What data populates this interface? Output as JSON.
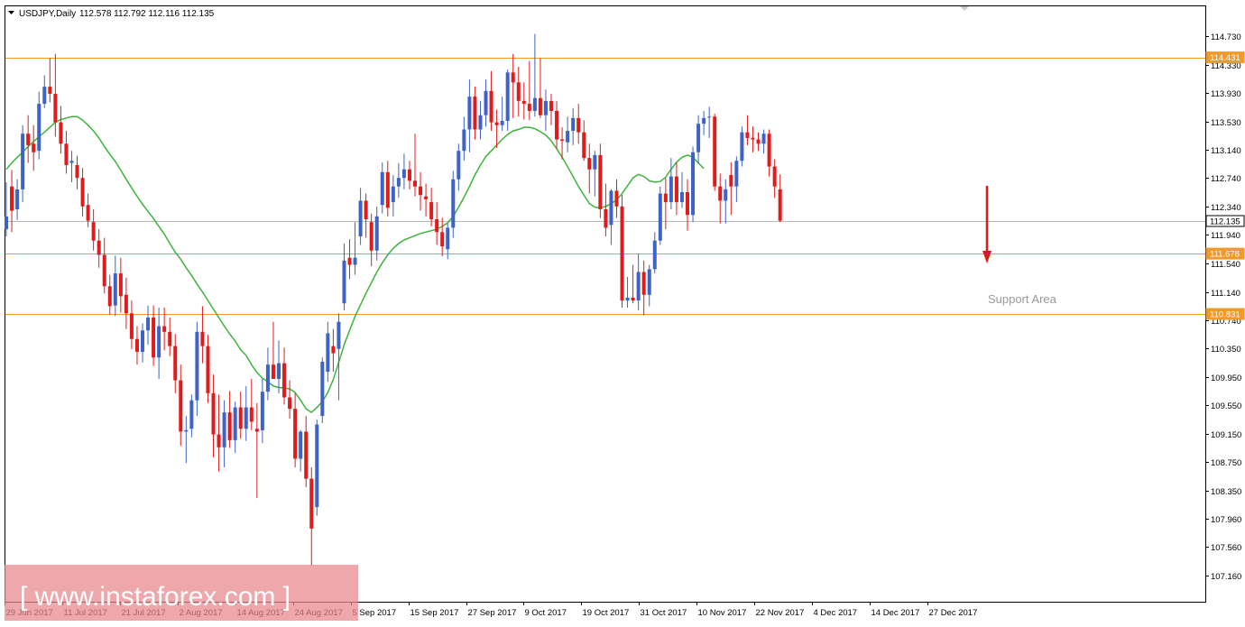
{
  "header": {
    "symbol_label": "USDJPY,Daily",
    "ohlc_label": "112.578 112.792 112.116 112.135"
  },
  "watermark": {
    "text": "[ www.instaforex.com ]"
  },
  "annotation": {
    "text": "Support Area"
  },
  "colors": {
    "bull": "#3f62c7",
    "bear": "#e01b1b",
    "ma": "#3cb43c",
    "level": "#f09a2a",
    "current": "#b8b8b8",
    "arrow": "#d81a1a",
    "watermark_bg": "#e8868c"
  },
  "chart_data": {
    "type": "candlestick",
    "title": "USDJPY,Daily",
    "y_ticks": [
      "114.730",
      "114.330",
      "113.930",
      "113.530",
      "113.140",
      "112.740",
      "112.340",
      "111.940",
      "111.540",
      "111.140",
      "110.740",
      "110.350",
      "109.950",
      "109.550",
      "109.150",
      "108.750",
      "108.350",
      "107.960",
      "107.560",
      "107.160"
    ],
    "x_tick_labels": [
      "29 Jun 2017",
      "11 Jul 2017",
      "21 Jul 2017",
      "2 Aug 2017",
      "14 Aug 2017",
      "24 Aug 2017",
      "5 Sep 2017",
      "15 Sep 2017",
      "27 Sep 2017",
      "9 Oct 2017",
      "19 Oct 2017",
      "31 Oct 2017",
      "10 Nov 2017",
      "22 Nov 2017",
      "4 Dec 2017",
      "14 Dec 2017",
      "27 Dec 2017"
    ],
    "ylim": [
      107.04,
      115.04
    ],
    "horizontal_levels": [
      {
        "value": 114.431,
        "label": "114.431",
        "kind": "resistance"
      },
      {
        "value": 111.678,
        "label": "111.678",
        "kind": "support"
      },
      {
        "value": 110.831,
        "label": "110.831",
        "kind": "support"
      },
      {
        "value": 112.135,
        "label": "112.135",
        "kind": "current"
      }
    ],
    "ma_series": [
      112.86,
      112.95,
      113.03,
      113.1,
      113.18,
      113.25,
      113.32,
      113.38,
      113.45,
      113.52,
      113.56,
      113.58,
      113.6,
      113.6,
      113.55,
      113.48,
      113.4,
      113.3,
      113.18,
      113.07,
      112.97,
      112.85,
      112.72,
      112.6,
      112.48,
      112.37,
      112.27,
      112.17,
      112.06,
      111.95,
      111.82,
      111.7,
      111.6,
      111.48,
      111.37,
      111.25,
      111.14,
      111.02,
      110.9,
      110.78,
      110.66,
      110.55,
      110.45,
      110.33,
      110.25,
      110.12,
      110.01,
      109.93,
      109.88,
      109.82,
      109.8,
      109.79,
      109.78,
      109.73,
      109.62,
      109.5,
      109.45,
      109.52,
      109.6,
      109.73,
      109.91,
      110.15,
      110.4,
      110.6,
      110.8,
      110.96,
      111.12,
      111.27,
      111.42,
      111.55,
      111.66,
      111.75,
      111.82,
      111.87,
      111.9,
      111.93,
      111.96,
      111.98,
      112.0,
      112.02,
      112.06,
      112.11,
      112.2,
      112.33,
      112.47,
      112.62,
      112.78,
      112.92,
      113.04,
      113.12,
      113.2,
      113.28,
      113.35,
      113.4,
      113.42,
      113.45,
      113.45,
      113.43,
      113.39,
      113.34,
      113.26,
      113.15,
      113.03,
      112.9,
      112.76,
      112.62,
      112.5,
      112.38,
      112.33,
      112.32,
      112.34,
      112.38,
      112.43,
      112.52,
      112.63,
      112.74,
      112.79,
      112.76,
      112.7,
      112.68,
      112.69,
      112.75,
      112.86,
      112.96,
      113.03,
      113.06,
      113.03,
      112.95,
      112.87
    ],
    "candles": [
      {
        "o": 112.02,
        "h": 112.68,
        "l": 111.92,
        "c": 112.2
      },
      {
        "o": 112.62,
        "h": 112.85,
        "l": 111.98,
        "c": 112.28
      },
      {
        "o": 112.3,
        "h": 112.72,
        "l": 112.15,
        "c": 112.58
      },
      {
        "o": 112.58,
        "h": 113.48,
        "l": 112.4,
        "c": 113.36
      },
      {
        "o": 113.36,
        "h": 113.62,
        "l": 112.95,
        "c": 113.2
      },
      {
        "o": 113.22,
        "h": 113.48,
        "l": 112.84,
        "c": 113.1
      },
      {
        "o": 113.12,
        "h": 113.95,
        "l": 113.0,
        "c": 113.78
      },
      {
        "o": 113.78,
        "h": 114.18,
        "l": 113.72,
        "c": 114.02
      },
      {
        "o": 114.02,
        "h": 114.42,
        "l": 113.8,
        "c": 113.92
      },
      {
        "o": 113.92,
        "h": 114.48,
        "l": 113.32,
        "c": 113.52
      },
      {
        "o": 113.52,
        "h": 113.75,
        "l": 113.08,
        "c": 113.22
      },
      {
        "o": 113.22,
        "h": 113.4,
        "l": 112.8,
        "c": 112.92
      },
      {
        "o": 112.95,
        "h": 113.12,
        "l": 112.68,
        "c": 112.98
      },
      {
        "o": 112.92,
        "h": 113.05,
        "l": 112.58,
        "c": 112.74
      },
      {
        "o": 112.74,
        "h": 112.88,
        "l": 112.2,
        "c": 112.34
      },
      {
        "o": 112.36,
        "h": 112.52,
        "l": 112.05,
        "c": 112.14
      },
      {
        "o": 112.12,
        "h": 112.3,
        "l": 111.72,
        "c": 111.86
      },
      {
        "o": 111.86,
        "h": 112.02,
        "l": 111.48,
        "c": 111.66
      },
      {
        "o": 111.66,
        "h": 111.9,
        "l": 111.12,
        "c": 111.22
      },
      {
        "o": 111.22,
        "h": 111.38,
        "l": 110.82,
        "c": 110.94
      },
      {
        "o": 110.95,
        "h": 111.65,
        "l": 110.8,
        "c": 111.4
      },
      {
        "o": 111.4,
        "h": 111.62,
        "l": 110.85,
        "c": 111.08
      },
      {
        "o": 111.1,
        "h": 111.34,
        "l": 110.62,
        "c": 110.84
      },
      {
        "o": 110.84,
        "h": 111.02,
        "l": 110.34,
        "c": 110.48
      },
      {
        "o": 110.48,
        "h": 110.66,
        "l": 110.12,
        "c": 110.3
      },
      {
        "o": 110.3,
        "h": 110.7,
        "l": 110.15,
        "c": 110.6
      },
      {
        "o": 110.6,
        "h": 110.95,
        "l": 110.4,
        "c": 110.78
      },
      {
        "o": 110.78,
        "h": 110.95,
        "l": 110.1,
        "c": 110.22
      },
      {
        "o": 110.22,
        "h": 110.92,
        "l": 109.92,
        "c": 110.66
      },
      {
        "o": 110.66,
        "h": 110.92,
        "l": 110.32,
        "c": 110.58
      },
      {
        "o": 110.58,
        "h": 110.78,
        "l": 110.24,
        "c": 110.38
      },
      {
        "o": 110.38,
        "h": 110.55,
        "l": 109.72,
        "c": 109.9
      },
      {
        "o": 109.9,
        "h": 110.12,
        "l": 108.98,
        "c": 109.18
      },
      {
        "o": 109.18,
        "h": 109.4,
        "l": 108.74,
        "c": 109.2
      },
      {
        "o": 109.22,
        "h": 109.7,
        "l": 109.1,
        "c": 109.62
      },
      {
        "o": 109.62,
        "h": 110.72,
        "l": 109.4,
        "c": 110.58
      },
      {
        "o": 110.58,
        "h": 110.94,
        "l": 110.14,
        "c": 110.38
      },
      {
        "o": 110.38,
        "h": 110.54,
        "l": 109.58,
        "c": 109.72
      },
      {
        "o": 109.72,
        "h": 109.98,
        "l": 108.82,
        "c": 109.14
      },
      {
        "o": 109.14,
        "h": 109.7,
        "l": 108.62,
        "c": 108.96
      },
      {
        "o": 108.96,
        "h": 109.62,
        "l": 108.68,
        "c": 109.45
      },
      {
        "o": 109.45,
        "h": 109.75,
        "l": 108.95,
        "c": 109.06
      },
      {
        "o": 109.06,
        "h": 109.6,
        "l": 108.88,
        "c": 109.52
      },
      {
        "o": 109.52,
        "h": 109.74,
        "l": 109.08,
        "c": 109.22
      },
      {
        "o": 109.22,
        "h": 109.82,
        "l": 109.05,
        "c": 109.52
      },
      {
        "o": 109.52,
        "h": 109.92,
        "l": 109.2,
        "c": 109.32
      },
      {
        "o": 109.22,
        "h": 109.58,
        "l": 108.25,
        "c": 109.18
      },
      {
        "o": 109.2,
        "h": 109.92,
        "l": 109.02,
        "c": 109.74
      },
      {
        "o": 109.74,
        "h": 110.36,
        "l": 109.62,
        "c": 110.12
      },
      {
        "o": 110.12,
        "h": 110.72,
        "l": 109.92,
        "c": 109.92
      },
      {
        "o": 109.92,
        "h": 110.46,
        "l": 109.72,
        "c": 110.14
      },
      {
        "o": 110.14,
        "h": 110.36,
        "l": 109.56,
        "c": 109.66
      },
      {
        "o": 109.66,
        "h": 109.9,
        "l": 109.36,
        "c": 109.5
      },
      {
        "o": 109.5,
        "h": 109.72,
        "l": 108.68,
        "c": 108.8
      },
      {
        "o": 108.8,
        "h": 109.2,
        "l": 108.62,
        "c": 109.18
      },
      {
        "o": 109.18,
        "h": 109.4,
        "l": 108.4,
        "c": 108.52
      },
      {
        "o": 108.52,
        "h": 108.68,
        "l": 107.3,
        "c": 107.82
      },
      {
        "o": 108.12,
        "h": 109.35,
        "l": 108.0,
        "c": 109.28
      },
      {
        "o": 109.4,
        "h": 110.22,
        "l": 109.3,
        "c": 110.16
      },
      {
        "o": 110.02,
        "h": 110.72,
        "l": 109.88,
        "c": 110.56
      },
      {
        "o": 110.38,
        "h": 110.62,
        "l": 110.02,
        "c": 110.28
      },
      {
        "o": 110.34,
        "h": 110.84,
        "l": 109.62,
        "c": 110.72
      },
      {
        "o": 110.98,
        "h": 111.82,
        "l": 110.88,
        "c": 111.58
      },
      {
        "o": 111.62,
        "h": 111.88,
        "l": 111.32,
        "c": 111.52
      },
      {
        "o": 111.52,
        "h": 112.12,
        "l": 111.38,
        "c": 111.62
      },
      {
        "o": 111.92,
        "h": 112.6,
        "l": 111.8,
        "c": 112.42
      },
      {
        "o": 112.42,
        "h": 112.52,
        "l": 111.9,
        "c": 112.16
      },
      {
        "o": 112.12,
        "h": 112.24,
        "l": 111.5,
        "c": 111.72
      },
      {
        "o": 111.72,
        "h": 112.34,
        "l": 111.58,
        "c": 112.2
      },
      {
        "o": 112.36,
        "h": 112.96,
        "l": 112.24,
        "c": 112.82
      },
      {
        "o": 112.82,
        "h": 112.98,
        "l": 112.2,
        "c": 112.32
      },
      {
        "o": 112.4,
        "h": 112.78,
        "l": 112.2,
        "c": 112.62
      },
      {
        "o": 112.62,
        "h": 112.95,
        "l": 112.46,
        "c": 112.74
      },
      {
        "o": 112.74,
        "h": 113.08,
        "l": 112.58,
        "c": 112.86
      },
      {
        "o": 112.86,
        "h": 112.98,
        "l": 112.58,
        "c": 112.7
      },
      {
        "o": 112.7,
        "h": 113.36,
        "l": 112.48,
        "c": 112.62
      },
      {
        "o": 112.62,
        "h": 112.82,
        "l": 112.28,
        "c": 112.5
      },
      {
        "o": 112.48,
        "h": 112.66,
        "l": 112.2,
        "c": 112.44
      },
      {
        "o": 112.4,
        "h": 112.6,
        "l": 112.06,
        "c": 112.16
      },
      {
        "o": 112.16,
        "h": 112.4,
        "l": 111.8,
        "c": 111.98
      },
      {
        "o": 111.98,
        "h": 112.18,
        "l": 111.64,
        "c": 111.78
      },
      {
        "o": 111.74,
        "h": 112.1,
        "l": 111.6,
        "c": 112.04
      },
      {
        "o": 112.04,
        "h": 112.84,
        "l": 111.9,
        "c": 112.72
      },
      {
        "o": 112.72,
        "h": 113.22,
        "l": 112.56,
        "c": 113.12
      },
      {
        "o": 113.12,
        "h": 113.6,
        "l": 112.98,
        "c": 113.42
      },
      {
        "o": 113.42,
        "h": 114.12,
        "l": 113.1,
        "c": 113.88
      },
      {
        "o": 113.88,
        "h": 114.02,
        "l": 113.28,
        "c": 113.42
      },
      {
        "o": 113.42,
        "h": 113.82,
        "l": 113.28,
        "c": 113.62
      },
      {
        "o": 113.62,
        "h": 114.12,
        "l": 113.46,
        "c": 113.96
      },
      {
        "o": 113.96,
        "h": 114.24,
        "l": 113.4,
        "c": 113.52
      },
      {
        "o": 113.52,
        "h": 113.7,
        "l": 113.16,
        "c": 113.48
      },
      {
        "o": 113.48,
        "h": 113.88,
        "l": 113.4,
        "c": 113.54
      },
      {
        "o": 113.54,
        "h": 114.26,
        "l": 113.4,
        "c": 114.22
      },
      {
        "o": 114.22,
        "h": 114.48,
        "l": 113.58,
        "c": 114.08
      },
      {
        "o": 114.08,
        "h": 114.3,
        "l": 113.6,
        "c": 113.82
      },
      {
        "o": 113.82,
        "h": 114.08,
        "l": 113.56,
        "c": 113.78
      },
      {
        "o": 113.78,
        "h": 114.38,
        "l": 113.55,
        "c": 113.68
      },
      {
        "o": 113.68,
        "h": 114.76,
        "l": 113.6,
        "c": 113.86
      },
      {
        "o": 113.86,
        "h": 114.42,
        "l": 113.58,
        "c": 113.62
      },
      {
        "o": 113.62,
        "h": 113.98,
        "l": 113.4,
        "c": 113.82
      },
      {
        "o": 113.82,
        "h": 113.92,
        "l": 113.48,
        "c": 113.68
      },
      {
        "o": 113.68,
        "h": 113.82,
        "l": 113.15,
        "c": 113.28
      },
      {
        "o": 113.28,
        "h": 113.45,
        "l": 113.0,
        "c": 113.26
      },
      {
        "o": 113.24,
        "h": 113.6,
        "l": 113.1,
        "c": 113.4
      },
      {
        "o": 113.4,
        "h": 113.72,
        "l": 113.2,
        "c": 113.58
      },
      {
        "o": 113.58,
        "h": 113.78,
        "l": 113.22,
        "c": 113.38
      },
      {
        "o": 113.38,
        "h": 113.55,
        "l": 112.98,
        "c": 113.02
      },
      {
        "o": 113.02,
        "h": 113.22,
        "l": 112.52,
        "c": 112.86
      },
      {
        "o": 112.86,
        "h": 113.12,
        "l": 112.48,
        "c": 113.06
      },
      {
        "o": 113.06,
        "h": 113.22,
        "l": 112.18,
        "c": 112.3
      },
      {
        "o": 112.3,
        "h": 112.66,
        "l": 111.92,
        "c": 112.04
      },
      {
        "o": 112.08,
        "h": 112.58,
        "l": 111.8,
        "c": 112.56
      },
      {
        "o": 112.56,
        "h": 112.72,
        "l": 112.18,
        "c": 112.34
      },
      {
        "o": 112.34,
        "h": 112.5,
        "l": 110.92,
        "c": 111.02
      },
      {
        "o": 111.02,
        "h": 111.35,
        "l": 110.92,
        "c": 111.06
      },
      {
        "o": 111.06,
        "h": 111.52,
        "l": 110.98,
        "c": 111.02
      },
      {
        "o": 111.02,
        "h": 111.68,
        "l": 110.88,
        "c": 111.42
      },
      {
        "o": 111.42,
        "h": 111.58,
        "l": 110.81,
        "c": 111.1
      },
      {
        "o": 111.1,
        "h": 111.52,
        "l": 110.94,
        "c": 111.46
      },
      {
        "o": 111.46,
        "h": 111.98,
        "l": 111.4,
        "c": 111.86
      },
      {
        "o": 111.86,
        "h": 112.62,
        "l": 111.8,
        "c": 112.52
      },
      {
        "o": 112.52,
        "h": 112.74,
        "l": 112.02,
        "c": 112.4
      },
      {
        "o": 112.4,
        "h": 113.02,
        "l": 112.3,
        "c": 112.76
      },
      {
        "o": 112.76,
        "h": 112.96,
        "l": 112.22,
        "c": 112.4
      },
      {
        "o": 112.4,
        "h": 112.82,
        "l": 112.32,
        "c": 112.54
      },
      {
        "o": 112.54,
        "h": 112.72,
        "l": 112.0,
        "c": 112.22
      },
      {
        "o": 112.22,
        "h": 113.18,
        "l": 112.12,
        "c": 113.1
      },
      {
        "o": 113.1,
        "h": 113.62,
        "l": 112.94,
        "c": 113.5
      },
      {
        "o": 113.5,
        "h": 113.68,
        "l": 113.34,
        "c": 113.58
      },
      {
        "o": 113.6,
        "h": 113.74,
        "l": 113.3,
        "c": 113.6
      },
      {
        "o": 113.6,
        "h": 113.64,
        "l": 112.56,
        "c": 112.62
      },
      {
        "o": 112.62,
        "h": 112.8,
        "l": 112.1,
        "c": 112.42
      },
      {
        "o": 112.42,
        "h": 112.72,
        "l": 112.1,
        "c": 112.58
      },
      {
        "o": 112.78,
        "h": 112.96,
        "l": 112.22,
        "c": 112.62
      },
      {
        "o": 112.62,
        "h": 113.04,
        "l": 112.4,
        "c": 112.98
      },
      {
        "o": 112.98,
        "h": 113.46,
        "l": 112.9,
        "c": 113.38
      },
      {
        "o": 113.38,
        "h": 113.62,
        "l": 113.2,
        "c": 113.3
      },
      {
        "o": 113.3,
        "h": 113.46,
        "l": 113.1,
        "c": 113.28
      },
      {
        "o": 113.28,
        "h": 113.38,
        "l": 113.12,
        "c": 113.22
      },
      {
        "o": 113.22,
        "h": 113.42,
        "l": 113.08,
        "c": 113.36
      },
      {
        "o": 113.36,
        "h": 113.42,
        "l": 112.76,
        "c": 112.9
      },
      {
        "o": 112.9,
        "h": 113.0,
        "l": 112.46,
        "c": 112.62
      },
      {
        "o": 112.58,
        "h": 112.79,
        "l": 112.12,
        "c": 112.14
      }
    ]
  }
}
